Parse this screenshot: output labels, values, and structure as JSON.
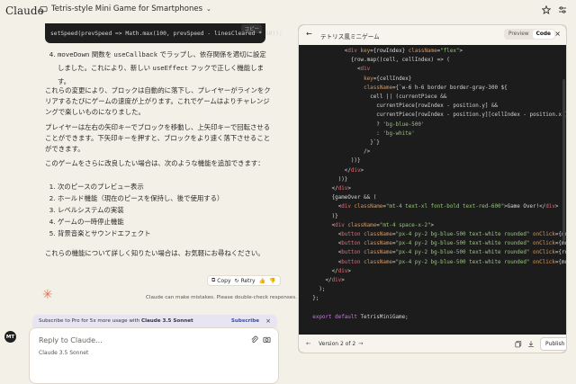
{
  "app": {
    "brand": "Claude"
  },
  "chat": {
    "title": "Tetris-style Mini Game for Smartphones"
  },
  "code_snippet": {
    "line": "setSpeed(prevSpeed => Math.max(100, prevSpeed - linesCleared * 50));",
    "copy": "コピー"
  },
  "message": {
    "item4_prefix": "moveDown",
    "item4_a": " 関数を ",
    "item4_b": "useCallback",
    "item4_c": " でラップし、依存関係を適切に設定しました。これにより、新しい ",
    "item4_d": "useEffect",
    "item4_e": " フックで正しく機能します。",
    "p1": "これらの変更により、ブロックは自動的に落下し、プレイヤーがラインをクリアするたびにゲームの速度が上がります。これでゲームはよりチャレンジングで楽しいものになりました。",
    "p2": "プレイヤーは左右の矢印キーでブロックを移動し、上矢印キーで回転させることができます。下矢印キーを押すと、ブロックをより速く落下させることができます。",
    "p3": "このゲームをさらに改良したい場合は、次のような機能を追加できます：",
    "features": [
      "次のピースのプレビュー表示",
      "ホールド機能（現在のピースを保持し、後で使用する）",
      "レベルシステムの実装",
      "ゲームの一時停止機能",
      "背景音楽とサウンドエフェクト"
    ],
    "p4": "これらの機能について詳しく知りたい場合は、お気軽にお尋ねください。"
  },
  "actions": {
    "copy": "Copy",
    "retry": "Retry"
  },
  "disclaimer": "Claude can make mistakes. Please double-check responses.",
  "promo": {
    "text_a": "Subscribe to Pro for 5x more usage with ",
    "text_b": "Claude 3.5 Sonnet",
    "subscribe": "Subscribe"
  },
  "composer": {
    "placeholder": "Reply to Claude...",
    "model": "Claude 3.5 Sonnet"
  },
  "user": {
    "initials": "MT"
  },
  "artifact": {
    "title": "テトリス風ミニゲーム",
    "toggle": {
      "preview": "Preview",
      "code": "Code"
    },
    "version": "Version 2 of 2",
    "publish": "Publish"
  },
  "code_lines": [
    {
      "indent": 8,
      "text": "<div key={rowIndex} className=\"flex\">"
    },
    {
      "indent": 9,
      "text": "{row.map((cell, cellIndex) => ("
    },
    {
      "indent": 10,
      "text": "<div"
    },
    {
      "indent": 11,
      "text": "key={cellIndex}"
    },
    {
      "indent": 11,
      "text": "className={`w-6 h-6 border border-gray-300 ${"
    },
    {
      "indent": 12,
      "text": "cell || (currentPiece &&"
    },
    {
      "indent": 13,
      "text": "currentPiece[rowIndex - position.y] &&"
    },
    {
      "indent": 13,
      "text": "currentPiece[rowIndex - position.y][cellIndex - position.x])"
    },
    {
      "indent": 13,
      "text": "? 'bg-blue-500'"
    },
    {
      "indent": 13,
      "text": ": 'bg-white'"
    },
    {
      "indent": 12,
      "text": "}`}"
    },
    {
      "indent": 11,
      "text": "/>"
    },
    {
      "indent": 9,
      "text": "))}"
    },
    {
      "indent": 8,
      "text": "</div>"
    },
    {
      "indent": 7,
      "text": "))}"
    },
    {
      "indent": 6,
      "text": "</div>"
    },
    {
      "indent": 6,
      "text": "{gameOver && ("
    },
    {
      "indent": 7,
      "text": "<div className=\"mt-4 text-xl font-bold text-red-600\">Game Over!</div>"
    },
    {
      "indent": 6,
      "text": ")}"
    },
    {
      "indent": 6,
      "text": "<div className=\"mt-4 space-x-2\">"
    },
    {
      "indent": 7,
      "text": "<button className=\"px-4 py-2 bg-blue-500 text-white rounded\" onClick={moveLeft}>"
    },
    {
      "indent": 7,
      "text": "<button className=\"px-4 py-2 bg-blue-500 text-white rounded\" onClick={moveRight}"
    },
    {
      "indent": 7,
      "text": "<button className=\"px-4 py-2 bg-blue-500 text-white rounded\" onClick={rotate}>"
    },
    {
      "indent": 7,
      "text": "<button className=\"px-4 py-2 bg-blue-500 text-white rounded\" onClick={moveDown}>"
    },
    {
      "indent": 6,
      "text": "</div>"
    },
    {
      "indent": 5,
      "text": "</div>"
    },
    {
      "indent": 4,
      "text": ");"
    },
    {
      "indent": 3,
      "text": "};"
    },
    {
      "indent": 3,
      "text": ""
    },
    {
      "indent": 3,
      "text": "export default TetrisMiniGame;"
    }
  ]
}
